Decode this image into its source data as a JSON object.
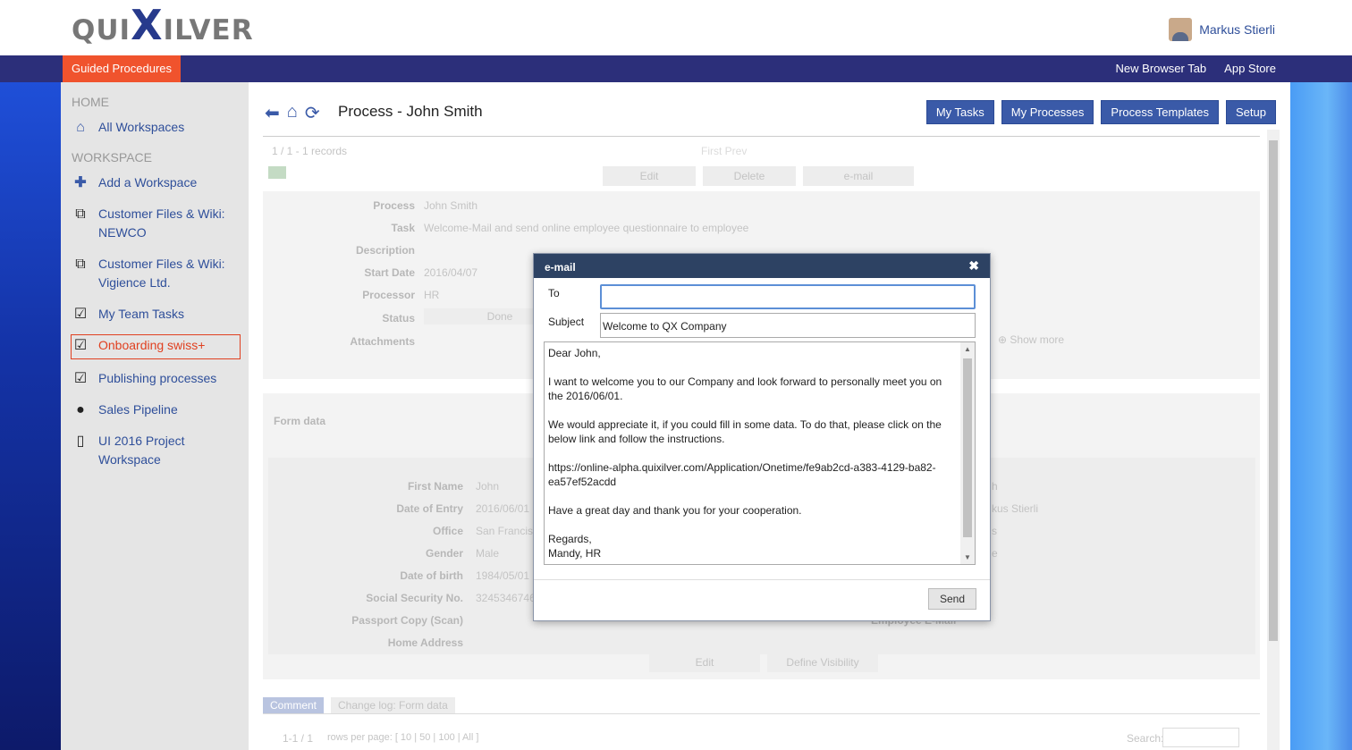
{
  "app": {
    "logo": "QUIXILVER",
    "user_name": "Markus Stierli"
  },
  "topnav": {
    "guided": "Guided Procedures",
    "right": [
      "New Browser Tab",
      "App Store"
    ]
  },
  "sidebar": {
    "home": "HOME",
    "all_workspaces": "All Workspaces",
    "workspace": "WORKSPACE",
    "items": [
      {
        "label": "Add a Workspace",
        "icon": "plus-icon"
      },
      {
        "label": "Customer Files & Wiki: NEWCO",
        "icon": "copy-icon"
      },
      {
        "label": "Customer Files & Wiki: Vigience Ltd.",
        "icon": "copy-icon"
      },
      {
        "label": "My Team Tasks",
        "icon": "check-icon"
      },
      {
        "label": "Onboarding swiss+",
        "icon": "check-icon"
      },
      {
        "label": "Publishing processes",
        "icon": "check-icon"
      },
      {
        "label": "Sales Pipeline",
        "icon": "user-icon"
      },
      {
        "label": "UI 2016 Project Workspace",
        "icon": "mobile-icon"
      }
    ]
  },
  "main": {
    "title": "Process - John Smith",
    "buttons": [
      "My Tasks",
      "My Processes",
      "Process Templates",
      "Setup"
    ],
    "records": "1 / 1 - 1 records",
    "pager": "First Prev",
    "actions": [
      "Edit",
      "Delete",
      "e-mail"
    ],
    "fields": [
      {
        "label": "Process",
        "value": "John Smith"
      },
      {
        "label": "Task",
        "value": "Welcome-Mail and send online employee questionnaire to employee"
      },
      {
        "label": "Description",
        "value": ""
      },
      {
        "label": "Start Date",
        "value": "2016/04/07"
      },
      {
        "label": "Processor",
        "value": "HR"
      },
      {
        "label": "Status",
        "value": "Done"
      },
      {
        "label": "Attachments",
        "value": ""
      }
    ],
    "show_more": "Show more",
    "collapse": "[-]",
    "form_data": "Form data",
    "form_fields": [
      {
        "label": "First Name",
        "value": "John"
      },
      {
        "label": "Date of Entry",
        "value": "2016/06/01"
      },
      {
        "label": "Office",
        "value": "San Francisc"
      },
      {
        "label": "Gender",
        "value": "Male"
      },
      {
        "label": "Date of birth",
        "value": "1984/05/01"
      },
      {
        "label": "Social Security No.",
        "value": "3245346746"
      },
      {
        "label": "Passport Copy (Scan)",
        "value": ""
      },
      {
        "label": "Home Address",
        "value": ""
      }
    ],
    "right_values": [
      "h",
      "kus Stierli",
      "s",
      "e"
    ],
    "employee_email": "Employee E-Mail",
    "form_actions": [
      "Edit",
      "Define Visibility"
    ],
    "tabs": [
      "Comment",
      "Change log: Form data"
    ],
    "footer_pager": "1-1 / 1",
    "rows_per_page": "rows per page: [ 10 | 50 | 100 | All ]",
    "search": "Search:"
  },
  "dialog": {
    "title": "e-mail",
    "to_label": "To",
    "to_value": "",
    "subject_label": "Subject",
    "subject_value": "Welcome to QX Company",
    "body": "Dear John,\n\nI want to welcome you to our Company and look forward to personally meet you on the 2016/06/01.\n\nWe would appreciate it, if you could fill in some data. To do that, please click on the below link and follow the instructions.\n\nhttps://online-alpha.quixilver.com/Application/Onetime/fe9ab2cd-a383-4129-ba82-ea57ef52acdd\n\nHave a great day and thank you for your cooperation.\n\nRegards,\nMandy, HR",
    "send": "Send"
  }
}
